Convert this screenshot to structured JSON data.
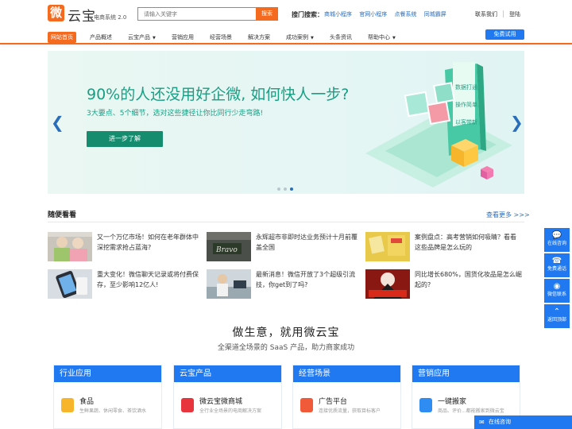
{
  "header": {
    "logo_char": "微",
    "logo_text": "云宝",
    "logo_sub": "电商系统 2.0",
    "search_placeholder": "请输入关键字",
    "search_btn": "搜索",
    "hot_label": "搜门搜索：",
    "hot_links": [
      "商城小程序",
      "官网小程序",
      "点餐系统",
      "同城霸屏"
    ],
    "contact": "联系我们",
    "login": "登陆"
  },
  "nav": {
    "items": [
      {
        "label": "网站首页",
        "active": true,
        "caret": false
      },
      {
        "label": "产品概述",
        "caret": false
      },
      {
        "label": "云宝产品",
        "caret": true
      },
      {
        "label": "营销应用",
        "caret": false
      },
      {
        "label": "经营场景",
        "caret": false
      },
      {
        "label": "解决方案",
        "caret": false
      },
      {
        "label": "成功案例",
        "caret": true
      },
      {
        "label": "头条资讯",
        "caret": false
      },
      {
        "label": "帮助中心",
        "caret": true
      }
    ],
    "trial": "免费试用"
  },
  "banner": {
    "title": "90%的人还没用好企微, 如何快人一步?",
    "subtitle": "3大要点、5个细节，选对这些捷径让你比同行少走弯路!",
    "button": "进一步了解",
    "phone_lines": [
      "数据打通",
      "操作简单",
      "以客带新"
    ]
  },
  "browse": {
    "title": "随便看看",
    "more": "查看更多 >>>",
    "articles": [
      {
        "text": "又一个万亿市场！如何在老年群体中深挖需求抢占蓝海?"
      },
      {
        "text": "永辉超市非即时达业务预计十月前覆盖全国"
      },
      {
        "text": "案例盘点：高考营销如何吸睛？看看这些品牌是怎么玩的"
      },
      {
        "text": "重大变化！微信聊天记录或将付费保存，至少影响12亿人!"
      },
      {
        "text": "最新消息！微信开放了3个超级引流技，你get到了吗?"
      },
      {
        "text": "同比增长680%，国货化妆品是怎么崛起的?"
      }
    ]
  },
  "solutions": {
    "title": "做生意，就用微云宝",
    "subtitle": "全渠道全场景的 SaaS 产品，助力商家成功",
    "cards": [
      {
        "head": "行业应用",
        "name": "食品",
        "desc": "生鲜果蔬、休闲零食、茶饮酒水",
        "color": "#f7b52c"
      },
      {
        "head": "云宝产品",
        "name": "微云宝微商城",
        "desc": "全行业全场景的电商解决方案",
        "color": "#e8343c"
      },
      {
        "head": "经营场景",
        "name": "广告平台",
        "desc": "连接优质流量，获取目标客户",
        "color": "#f15a38"
      },
      {
        "head": "营销应用",
        "name": "一键搬家",
        "desc": "商品、评价...都能搬家到微云宝",
        "color": "#2f8cf2"
      }
    ]
  },
  "side": {
    "items": [
      {
        "icon": "chat-icon",
        "label": "在线咨询"
      },
      {
        "icon": "phone-icon",
        "label": "免费通话"
      },
      {
        "icon": "wechat-icon",
        "label": "微信联系"
      },
      {
        "icon": "up-arrow-icon",
        "label": "返回顶部"
      }
    ]
  },
  "online_bar": "在线咨询"
}
